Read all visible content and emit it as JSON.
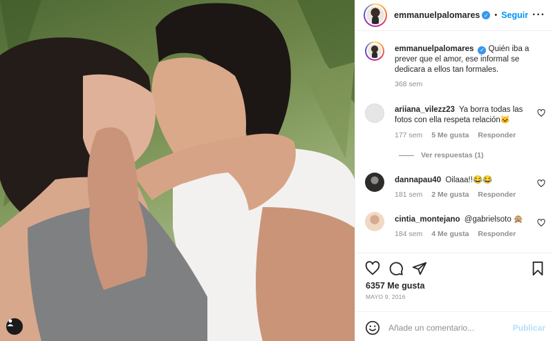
{
  "post": {
    "username": "emmanuelpalomares",
    "separator": "•",
    "follow_label": "Seguir",
    "more_icon": "more-horizontal-icon",
    "caption": "Quién iba a prever que el amor, ese informal se dedicara a ellos tan formales.",
    "caption_age": "368 sem"
  },
  "comments": [
    {
      "username": "ariiana_vilezz23",
      "text": "Ya borra todas las fotos con ella respeta relación🐱",
      "age": "177 sem",
      "likes": "5 Me gusta",
      "reply_label": "Responder",
      "view_replies": "Ver respuestas (1)"
    },
    {
      "username": "dannapau40",
      "text": "Oilaaa!!😂😂",
      "age": "181 sem",
      "likes": "2 Me gusta",
      "reply_label": "Responder"
    },
    {
      "username": "cintia_montejano",
      "text": "@gabrielsoto 🙊",
      "age": "184 sem",
      "likes": "4 Me gusta",
      "reply_label": "Responder"
    }
  ],
  "footer": {
    "likes_count": "6357 Me gusta",
    "date": "MAYO 9, 2016",
    "comment_placeholder": "Añade un comentario...",
    "publish_label": "Publicar"
  },
  "colors": {
    "accent": "#0095f6",
    "muted": "#8e8e8e",
    "publish_disabled": "#b2dffc",
    "verified": "#3897f0"
  }
}
